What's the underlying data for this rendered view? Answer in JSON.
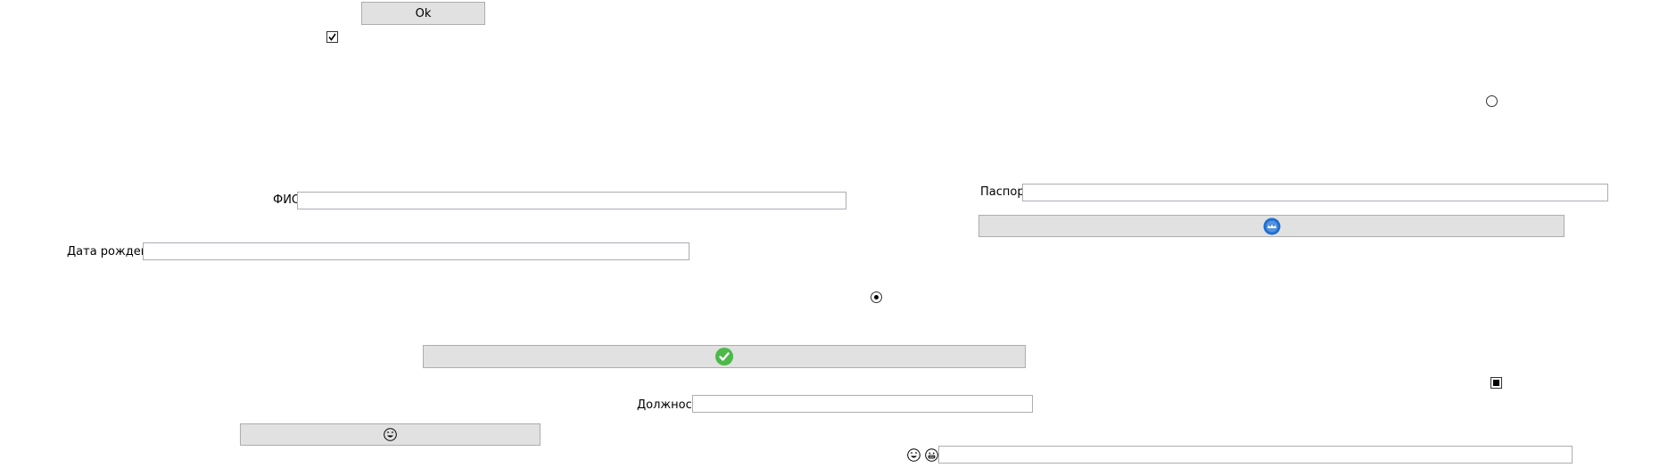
{
  "buttons": {
    "ok_label": "Ok"
  },
  "labels": {
    "fio": "ФИО",
    "birth_date": "Дата рождения",
    "passport": "Паспорт",
    "position": "Должность"
  },
  "inputs": {
    "fio": "",
    "birth_date": "",
    "passport": "",
    "position": "",
    "bottom_right": ""
  },
  "state": {
    "checkbox_top_checked": true,
    "checkbox_bottom_indeterminate": true,
    "radio_top_selected": false,
    "radio_mid_selected": true
  },
  "icons": {
    "confirm": "check-circle-icon",
    "passport_button": "blue-badge-icon",
    "smile_button": "smile-icon",
    "emoji_left": "laughing-face-icon",
    "emoji_right": "grinning-face-icon"
  },
  "colors": {
    "button_bg": "#e1e1e1",
    "button_border": "#adadad",
    "field_border": "#abadb3",
    "confirm_green": "#4cb948",
    "badge_blue": "#1f6fd1"
  }
}
